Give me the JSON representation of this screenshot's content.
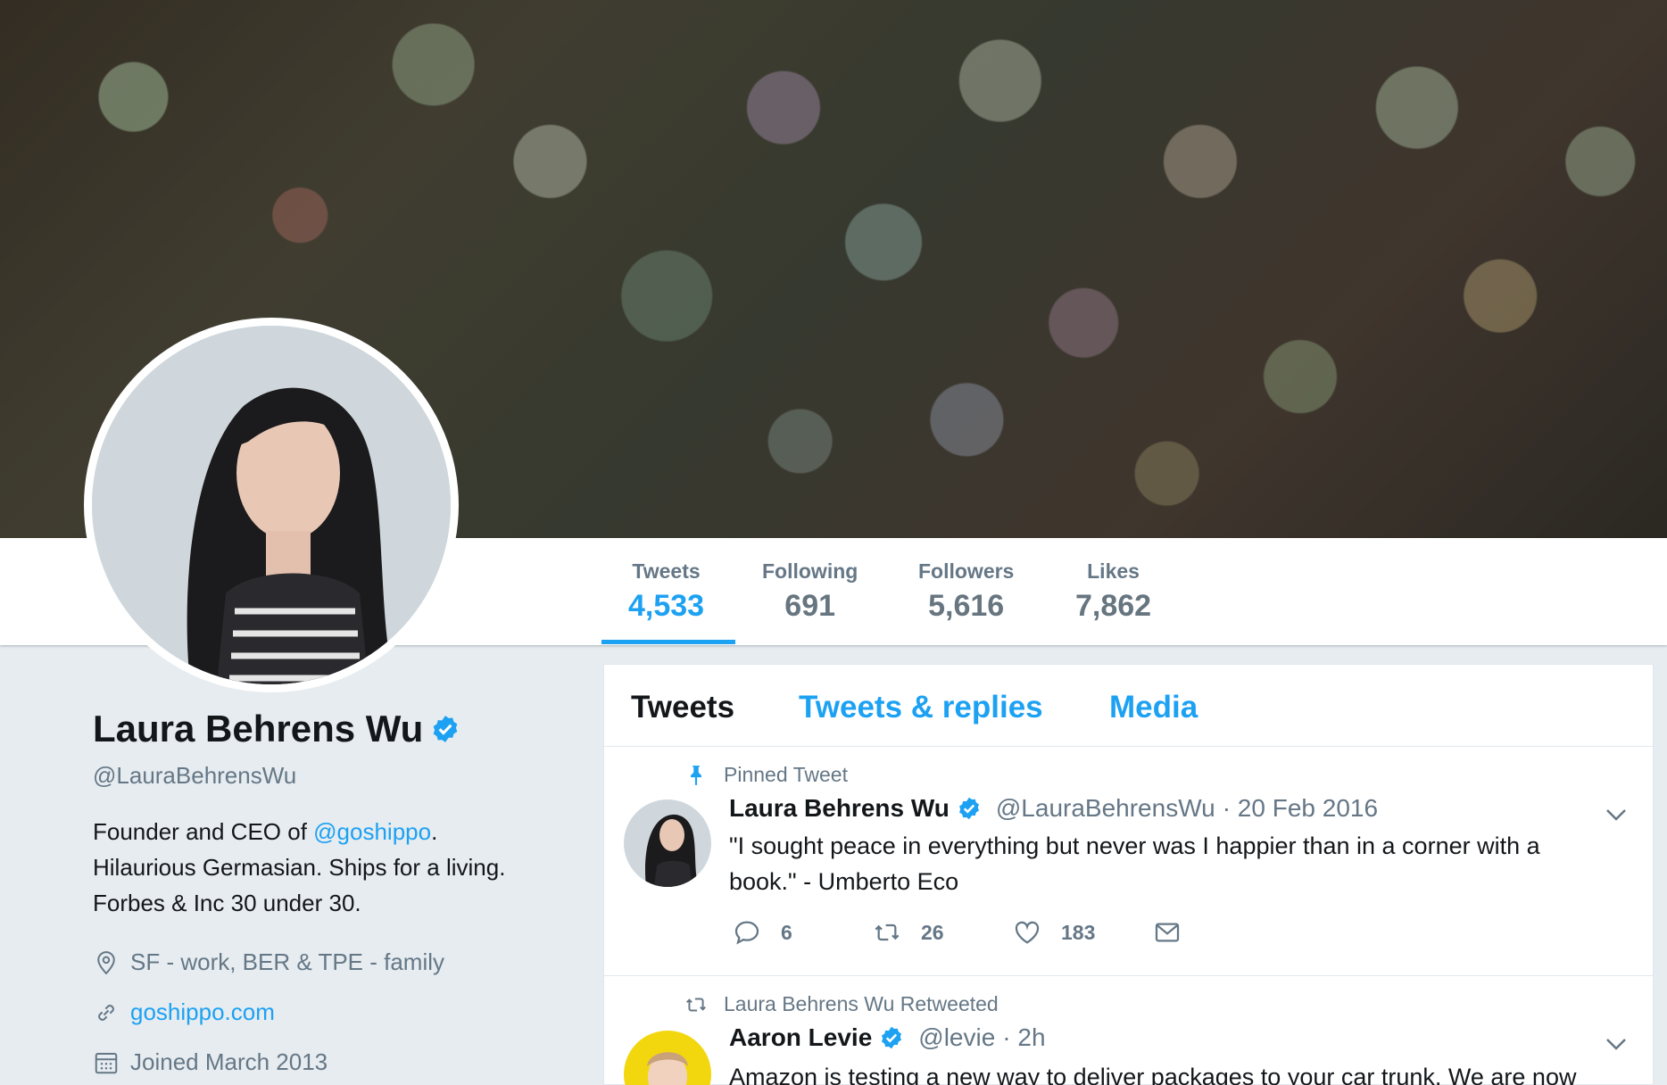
{
  "profile": {
    "name": "Laura Behrens Wu",
    "handle": "@LauraBehrensWu",
    "bio_prefix": "Founder and CEO of ",
    "bio_mention": "@goshippo",
    "bio_suffix": ".",
    "bio_line2": "Hilaurious Germasian. Ships for a living.",
    "bio_line3": "Forbes & Inc 30 under 30.",
    "location": "SF - work, BER & TPE - family",
    "website": "goshippo.com",
    "joined": "Joined March 2013"
  },
  "stats": [
    {
      "label": "Tweets",
      "value": "4,533",
      "active": true
    },
    {
      "label": "Following",
      "value": "691",
      "active": false
    },
    {
      "label": "Followers",
      "value": "5,616",
      "active": false
    },
    {
      "label": "Likes",
      "value": "7,862",
      "active": false
    }
  ],
  "tabs": [
    {
      "label": "Tweets",
      "active": true
    },
    {
      "label": "Tweets & replies",
      "active": false
    },
    {
      "label": "Media",
      "active": false
    }
  ],
  "tweets": [
    {
      "context": "Pinned Tweet",
      "context_icon": "pin-icon",
      "name": "Laura Behrens Wu",
      "handle": "@LauraBehrensWu",
      "date": "· 20 Feb 2016",
      "text": "\"I sought peace in everything but never was I happier than in a corner with a book.\" - Umberto Eco",
      "replies": "6",
      "retweets": "26",
      "likes": "183"
    },
    {
      "context": "Laura Behrens Wu Retweeted",
      "context_icon": "retweet-icon",
      "name": "Aaron Levie",
      "handle": "@levie",
      "date": "· 2h",
      "text": "Amazon is testing a new way to deliver packages to your car trunk. We are now"
    }
  ],
  "colors": {
    "accent": "#1da1f2",
    "text": "#14171a",
    "muted": "#657786",
    "background": "#e6ecf0"
  }
}
